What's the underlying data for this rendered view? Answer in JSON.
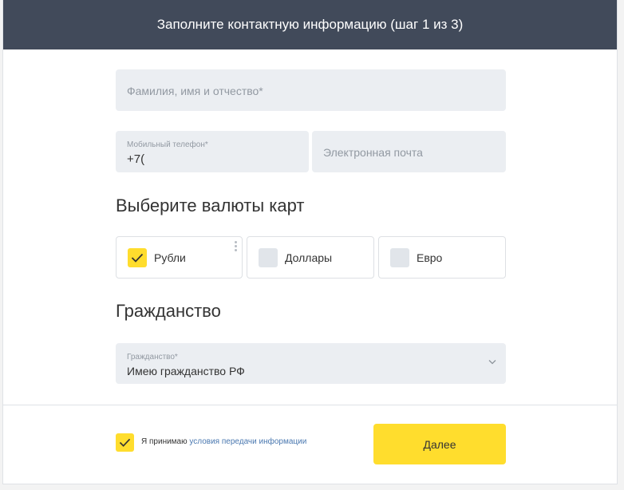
{
  "header": {
    "title": "Заполните контактную информацию (шаг 1 из 3)"
  },
  "form": {
    "full_name": {
      "placeholder": "Фамилия, имя и отчество*",
      "value": ""
    },
    "phone": {
      "label": "Мобильный телефон*",
      "value": "+7("
    },
    "email": {
      "placeholder": "Электронная почта",
      "value": ""
    }
  },
  "currencies": {
    "title": "Выберите валюты карт",
    "options": [
      {
        "label": "Рубли",
        "checked": true
      },
      {
        "label": "Доллары",
        "checked": false
      },
      {
        "label": "Евро",
        "checked": false
      }
    ]
  },
  "citizenship": {
    "title": "Гражданство",
    "label": "Гражданство*",
    "selected": "Имею гражданство РФ"
  },
  "footer": {
    "agree_prefix": "Я принимаю",
    "agree_link": "условия передачи информации",
    "agree_checked": true,
    "next_label": "Далее"
  },
  "colors": {
    "header_bg": "#414a5a",
    "accent_yellow": "#ffdd2d",
    "field_bg": "#ebeef2",
    "link": "#4a78b0"
  }
}
